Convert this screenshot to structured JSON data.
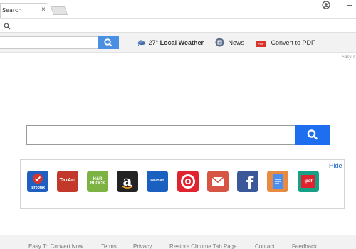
{
  "browser": {
    "tab_title": "Search",
    "tab_close": "×"
  },
  "toolbar": {
    "weather_temp": "27°",
    "weather_label": "Local Weather",
    "news_label": "News",
    "pdf_label": "Convert to PDF",
    "pdf_icon_text": "PDF"
  },
  "easy_link": "Easy T",
  "panel": {
    "hide_label": "Hide",
    "shortcuts": [
      {
        "name": "TurboTax",
        "text": "turbotax",
        "color": "#1f5fc1"
      },
      {
        "name": "TaxAct",
        "text": "TaxAct",
        "color": "#c2382b"
      },
      {
        "name": "H&R Block",
        "text": "H&R BLOCK",
        "color": "#7cb342"
      },
      {
        "name": "Amazon",
        "text": "a",
        "color": "#232323"
      },
      {
        "name": "Walmart",
        "text": "Walmart",
        "color": "#1a60c0"
      },
      {
        "name": "Target",
        "text": "",
        "color": "#e0242f"
      },
      {
        "name": "Gmail",
        "text": "",
        "color": "#d65544"
      },
      {
        "name": "Facebook",
        "text": "f",
        "color": "#3b5998"
      },
      {
        "name": "Docs",
        "text": "",
        "color": "#e88a42"
      },
      {
        "name": "PDF",
        "text": ".pdf",
        "color": "#16a085"
      }
    ]
  },
  "footer": {
    "links": [
      "Easy To Convert Now",
      "Terms",
      "Privacy",
      "Restore Chrome Tab Page",
      "Contact",
      "Feedback"
    ]
  }
}
